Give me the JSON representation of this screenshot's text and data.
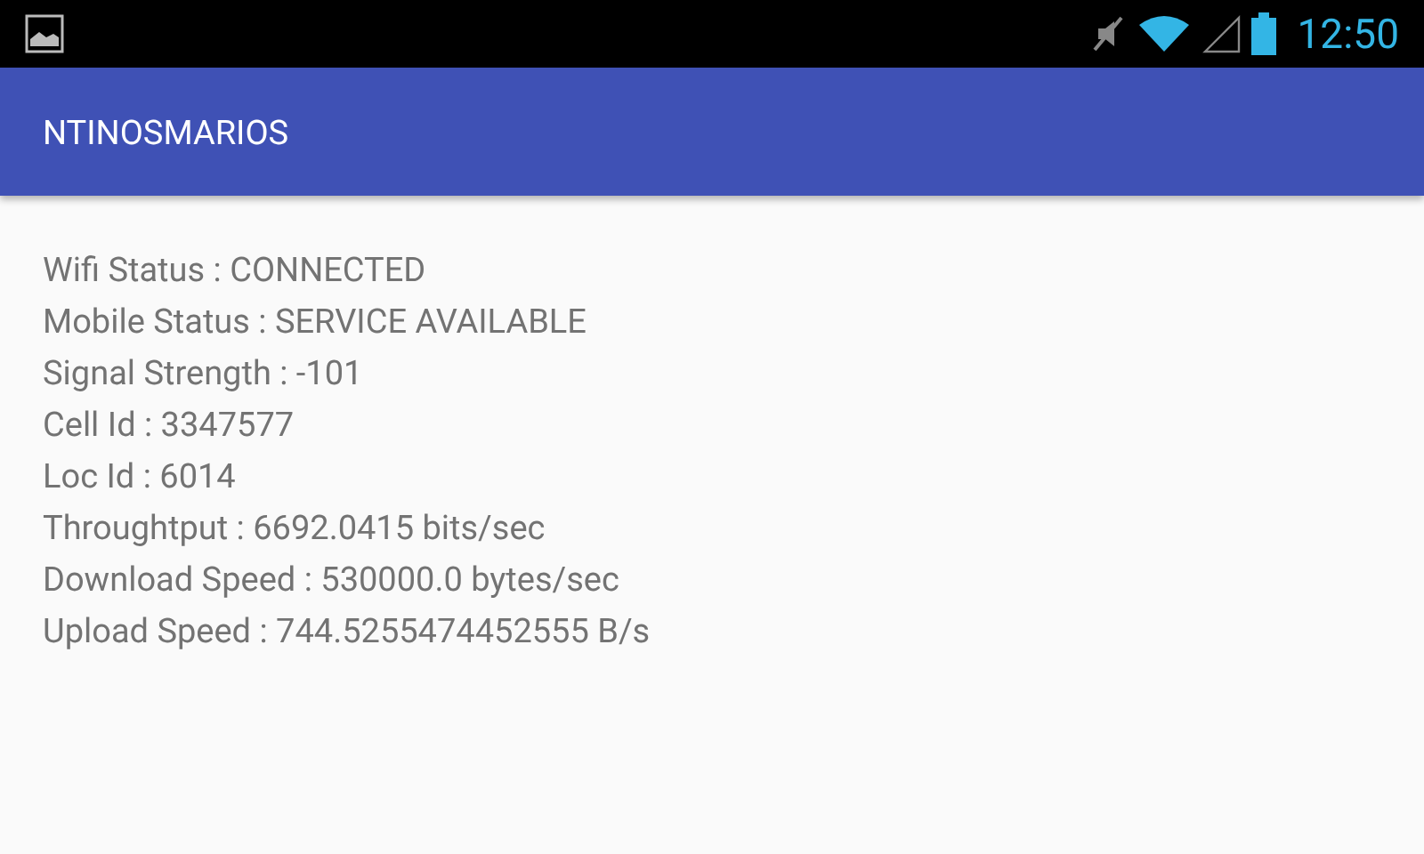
{
  "status_bar": {
    "time": "12:50"
  },
  "app_bar": {
    "title": "NTINOSMARIOS"
  },
  "lines": [
    "Wifi Status : CONNECTED",
    "Mobile Status : SERVICE AVAILABLE",
    "Signal Strength : -101",
    "Cell Id : 3347577",
    "Loc Id : 6014",
    "Throughtput : 6692.0415 bits/sec",
    "Download Speed : 530000.0 bytes/sec",
    "Upload Speed : 744.5255474452555 B/s"
  ]
}
